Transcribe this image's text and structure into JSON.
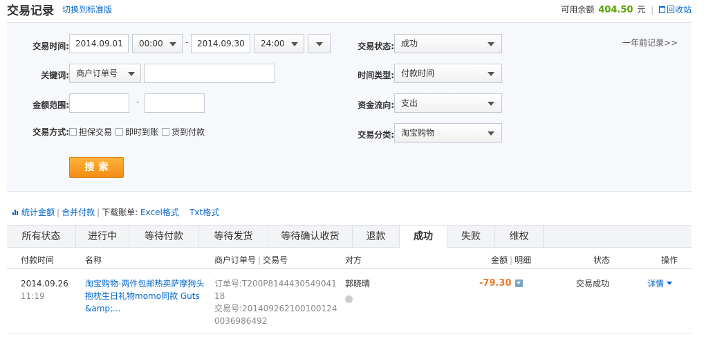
{
  "header": {
    "title": "交易记录",
    "switch_link": "切换到标准版",
    "balance_label": "可用余额",
    "balance_amount": "404.50",
    "balance_unit": "元",
    "recycle_label": "回收站"
  },
  "filters": {
    "time_label": "交易时间:",
    "start_date": "2014.09.01",
    "start_time": "00:00",
    "range_dash": "-",
    "end_date": "2014.09.30",
    "end_time": "24:00",
    "keyword_label": "关键词:",
    "keyword_type": "商户订单号",
    "keyword_value": "",
    "amount_label": "金额范围:",
    "amount_min": "",
    "amount_dash": "-",
    "amount_max": "",
    "method_label": "交易方式:",
    "methods": [
      "担保交易",
      "即时到账",
      "货到付款"
    ],
    "status_label": "交易状态:",
    "status_value": "成功",
    "time_type_label": "时间类型:",
    "time_type_value": "付款时间",
    "flow_label": "资金流向:",
    "flow_value": "支出",
    "category_label": "交易分类:",
    "category_value": "淘宝购物",
    "search_button": "搜索",
    "year_ago_link": "一年前记录>>"
  },
  "links": {
    "stats": "统计金额",
    "merge": "合并付款",
    "download_label": "下载账单:",
    "excel": "Excel格式",
    "txt": "Txt格式"
  },
  "tabs": [
    "所有状态",
    "进行中",
    "等待付款",
    "等待发货",
    "等待确认收货",
    "退款",
    "成功",
    "失败",
    "维权"
  ],
  "active_tab": "成功",
  "table": {
    "headers": {
      "pay_time": "付款时间",
      "name": "名称",
      "merchant_order": "商户订单号",
      "trade_no": "交易号",
      "party": "对方",
      "amount": "金额",
      "detail": "明细",
      "status": "状态",
      "operation": "操作"
    },
    "rows": [
      {
        "date": "2014.09.26",
        "time": "11:19",
        "name": "淘宝购物-两件包邮热卖萨摩狗头抱枕生日礼物momo同款 Guts&amp;...",
        "order_no": "订单号:T200P814443054904118",
        "trade_no": "交易号:2014092621001001240036986492",
        "party": "郭晓晴",
        "amount": "-79.30",
        "status": "交易成功",
        "operation": "详情"
      }
    ]
  },
  "colors": {
    "link": "#0066cc",
    "balance": "#54a100",
    "amount_negative": "#ee7722",
    "search_button": "#f7941d"
  }
}
